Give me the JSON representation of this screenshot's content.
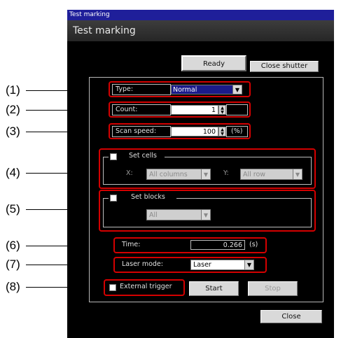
{
  "window": {
    "titlebar_text": "Test marking",
    "header_text": "Test marking"
  },
  "status": {
    "ready_label": "Ready",
    "close_shutter_label": "Close shutter"
  },
  "callouts": [
    "(1)",
    "(2)",
    "(3)",
    "(4)",
    "(5)",
    "(6)",
    "(7)",
    "(8)"
  ],
  "type": {
    "label": "Type:",
    "value": "Normal"
  },
  "count": {
    "label": "Count:",
    "value": "1"
  },
  "scan_speed": {
    "label": "Scan speed:",
    "value": "100",
    "unit": "(%)"
  },
  "set_cells": {
    "label": "Set cells",
    "x_label": "X:",
    "x_value": "All columns",
    "y_label": "Y:",
    "y_value": "All row"
  },
  "set_blocks": {
    "label": "Set blocks",
    "value": "All"
  },
  "time": {
    "label": "Time:",
    "value": "0.266",
    "unit": "(s)"
  },
  "laser_mode": {
    "label": "Laser mode:",
    "value": "Laser"
  },
  "trigger": {
    "label": "External trigger",
    "start_label": "Start",
    "stop_label": "Stop"
  },
  "footer": {
    "close_label": "Close"
  },
  "colors": {
    "callout_border": "#d40000",
    "title_bar": "#1f1f9a",
    "window_bg": "#000000"
  }
}
